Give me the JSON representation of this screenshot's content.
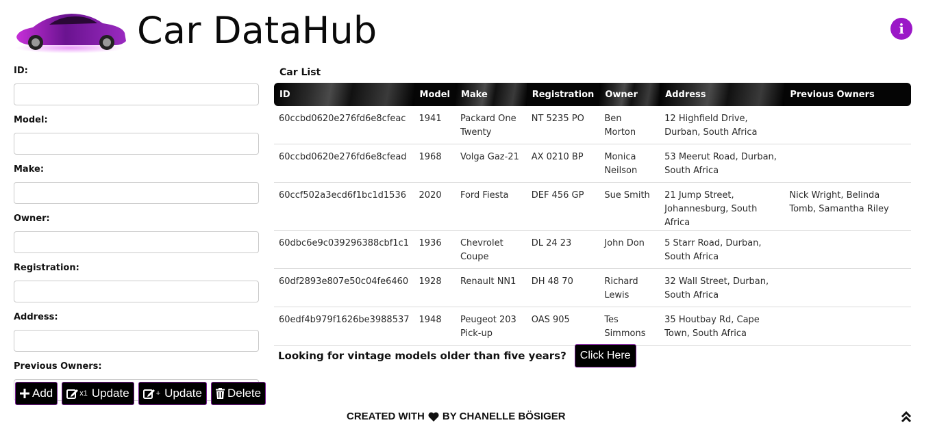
{
  "app": {
    "title": "Car DataHub",
    "accent": "#9b17c7"
  },
  "form": {
    "labels": {
      "id": "ID:",
      "model": "Model:",
      "make": "Make:",
      "owner": "Owner:",
      "registration": "Registration:",
      "address": "Address:",
      "previous_owners": "Previous Owners:"
    },
    "values": {
      "id": "",
      "model": "",
      "make": "",
      "owner": "",
      "registration": "",
      "address": "",
      "previous_owners": ""
    }
  },
  "buttons": {
    "add": "Add",
    "update_one_sub": "x1",
    "update_one": "Update",
    "update_many_sub": "+",
    "update_many": "Update",
    "delete": "Delete"
  },
  "car_list": {
    "title": "Car List",
    "columns": [
      "ID",
      "Model",
      "Make",
      "Registration",
      "Owner",
      "Address",
      "Previous Owners"
    ],
    "rows": [
      [
        "60ccbd0620e276fd6e8cfeac",
        "1941",
        "Packard One Twenty",
        "NT 5235 PO",
        "Ben Morton",
        "12 Highfield Drive, Durban, South Africa",
        ""
      ],
      [
        "60ccbd0620e276fd6e8cfead",
        "1968",
        "Volga Gaz-21",
        "AX 0210 BP",
        "Monica Neilson",
        "53 Meerut Road, Durban, South Africa",
        ""
      ],
      [
        "60ccf502a3ecd6f1bc1d1536",
        "2020",
        "Ford Fiesta",
        "DEF 456 GP",
        "Sue Smith",
        "21 Jump Street, Johannesburg, South Africa",
        "Nick Wright, Belinda Tomb, Samantha Riley"
      ],
      [
        "60dbc6e9c039296388cbf1c1",
        "1936",
        "Chevrolet Coupe",
        "DL 24 23",
        "John Don",
        "5 Starr Road, Durban, South Africa",
        ""
      ],
      [
        "60df2893e807e50c04fe6460",
        "1928",
        "Renault NN1",
        "DH 48 70",
        "Richard Lewis",
        "32 Wall Street, Durban, South Africa",
        ""
      ],
      [
        "60edf4b979f1626be3988537",
        "1948",
        "Peugeot 203 Pick-up",
        "OAS 905",
        "Tes Simmons",
        "35 Houtbay Rd, Cape Town, South Africa",
        ""
      ]
    ]
  },
  "vintage": {
    "text": "Looking for vintage models older than five years?",
    "button": "Click Here"
  },
  "footer": {
    "prefix": "CREATED WITH",
    "suffix": "BY CHANELLE BÖSIGER"
  },
  "icons": {
    "info": "info-icon",
    "heart": "heart-icon",
    "scroll_top": "double-chevron-up-icon"
  }
}
